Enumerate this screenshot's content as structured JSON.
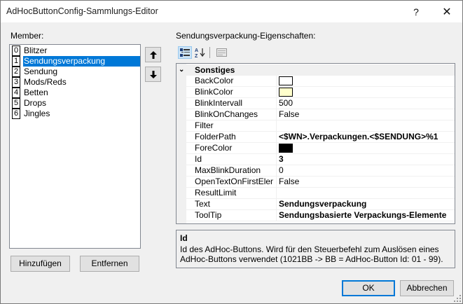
{
  "window": {
    "title": "AdHocButtonConfig-Sammlungs-Editor",
    "help_label": "?",
    "close_glyph": "✕"
  },
  "members": {
    "label": "Member:",
    "items": [
      {
        "index": "0",
        "name": "Blitzer"
      },
      {
        "index": "1",
        "name": "Sendungsverpackung",
        "selected": true
      },
      {
        "index": "2",
        "name": "Sendung"
      },
      {
        "index": "3",
        "name": "Mods/Reds"
      },
      {
        "index": "4",
        "name": "Betten"
      },
      {
        "index": "5",
        "name": "Drops"
      },
      {
        "index": "6",
        "name": "Jingles"
      }
    ]
  },
  "properties": {
    "label": "Sendungsverpackung-Eigenschaften:",
    "category": "Sonstiges",
    "rows": [
      {
        "name": "BackColor",
        "value": "",
        "swatch": "#ffffff"
      },
      {
        "name": "BlinkColor",
        "value": "",
        "swatch": "#ffffcc"
      },
      {
        "name": "BlinkIntervall",
        "value": "500"
      },
      {
        "name": "BlinkOnChanges",
        "value": "False"
      },
      {
        "name": "Filter",
        "value": ""
      },
      {
        "name": "FolderPath",
        "value": "<$WN>.Verpackungen.<$SENDUNG>%1",
        "bold": true
      },
      {
        "name": "ForeColor",
        "value": "",
        "swatch": "#000000"
      },
      {
        "name": "Id",
        "value": "3",
        "bold": true
      },
      {
        "name": "MaxBlinkDuration",
        "value": "0"
      },
      {
        "name": "OpenTextOnFirstElemen",
        "value": "False"
      },
      {
        "name": "ResultLimit",
        "value": ""
      },
      {
        "name": "Text",
        "value": "Sendungsverpackung",
        "bold": true
      },
      {
        "name": "ToolTip",
        "value": "Sendungsbasierte Verpackungs-Elemente",
        "bold": true
      }
    ]
  },
  "description": {
    "title": "Id",
    "text": "Id des AdHoc-Buttons. Wird für den Steuerbefehl zum Auslösen eines AdHoc-Buttons verwendet (1021BB -> BB = AdHoc-Button Id: 01 - 99)."
  },
  "buttons": {
    "add": "Hinzufügen",
    "remove": "Entfernen",
    "ok": "OK",
    "cancel": "Abbrechen"
  },
  "colors": {
    "selection": "#0078d7",
    "dialog_bg": "#f0f0f0",
    "default_border": "#0078d7"
  }
}
